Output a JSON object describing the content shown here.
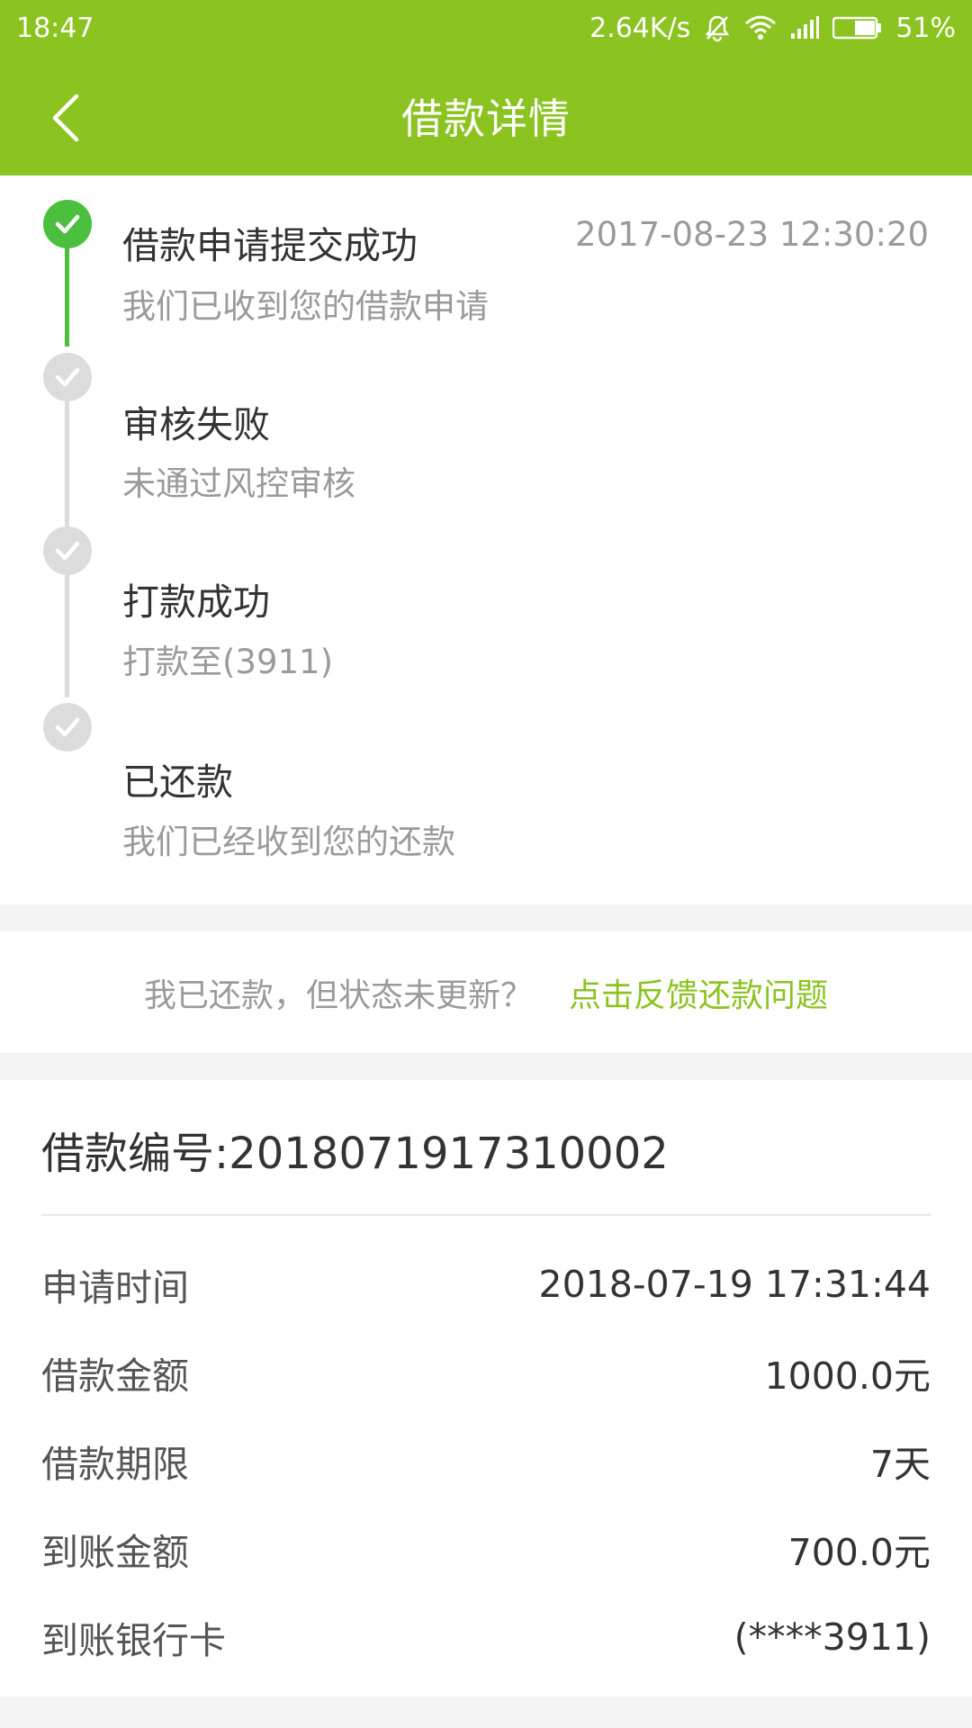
{
  "status_bar": {
    "time": "18:47",
    "speed": "2.64K/s",
    "battery": "51%",
    "icons": [
      "mute-icon",
      "wifi-icon",
      "signal-icon",
      "battery-icon"
    ]
  },
  "header": {
    "title": "借款详情",
    "back_icon": "chevron-left-icon",
    "accent": "#8bc320"
  },
  "timeline": [
    {
      "title": "借款申请提交成功",
      "desc": "我们已收到您的借款申请",
      "time": "2017-08-23 12:30:20",
      "state": "done"
    },
    {
      "title": "审核失败",
      "desc": "未通过风控审核",
      "time": "",
      "state": "todo"
    },
    {
      "title": "打款成功",
      "desc": "打款至(3911)",
      "time": "",
      "state": "todo"
    },
    {
      "title": "已还款",
      "desc": "我们已经收到您的还款",
      "time": "",
      "state": "todo"
    }
  ],
  "feedback": {
    "question": "我已还款，但状态未更新？",
    "link": "点击反馈还款问题"
  },
  "detail": {
    "loan_no": "借款编号:2018071917310002",
    "rows": [
      {
        "k": "申请时间",
        "v": "2018-07-19 17:31:44"
      },
      {
        "k": "借款金额",
        "v": "1000.0元"
      },
      {
        "k": "借款期限",
        "v": "7天"
      },
      {
        "k": "到账金额",
        "v": "700.0元"
      },
      {
        "k": "到账银行卡",
        "v": "(****3911)"
      }
    ]
  }
}
